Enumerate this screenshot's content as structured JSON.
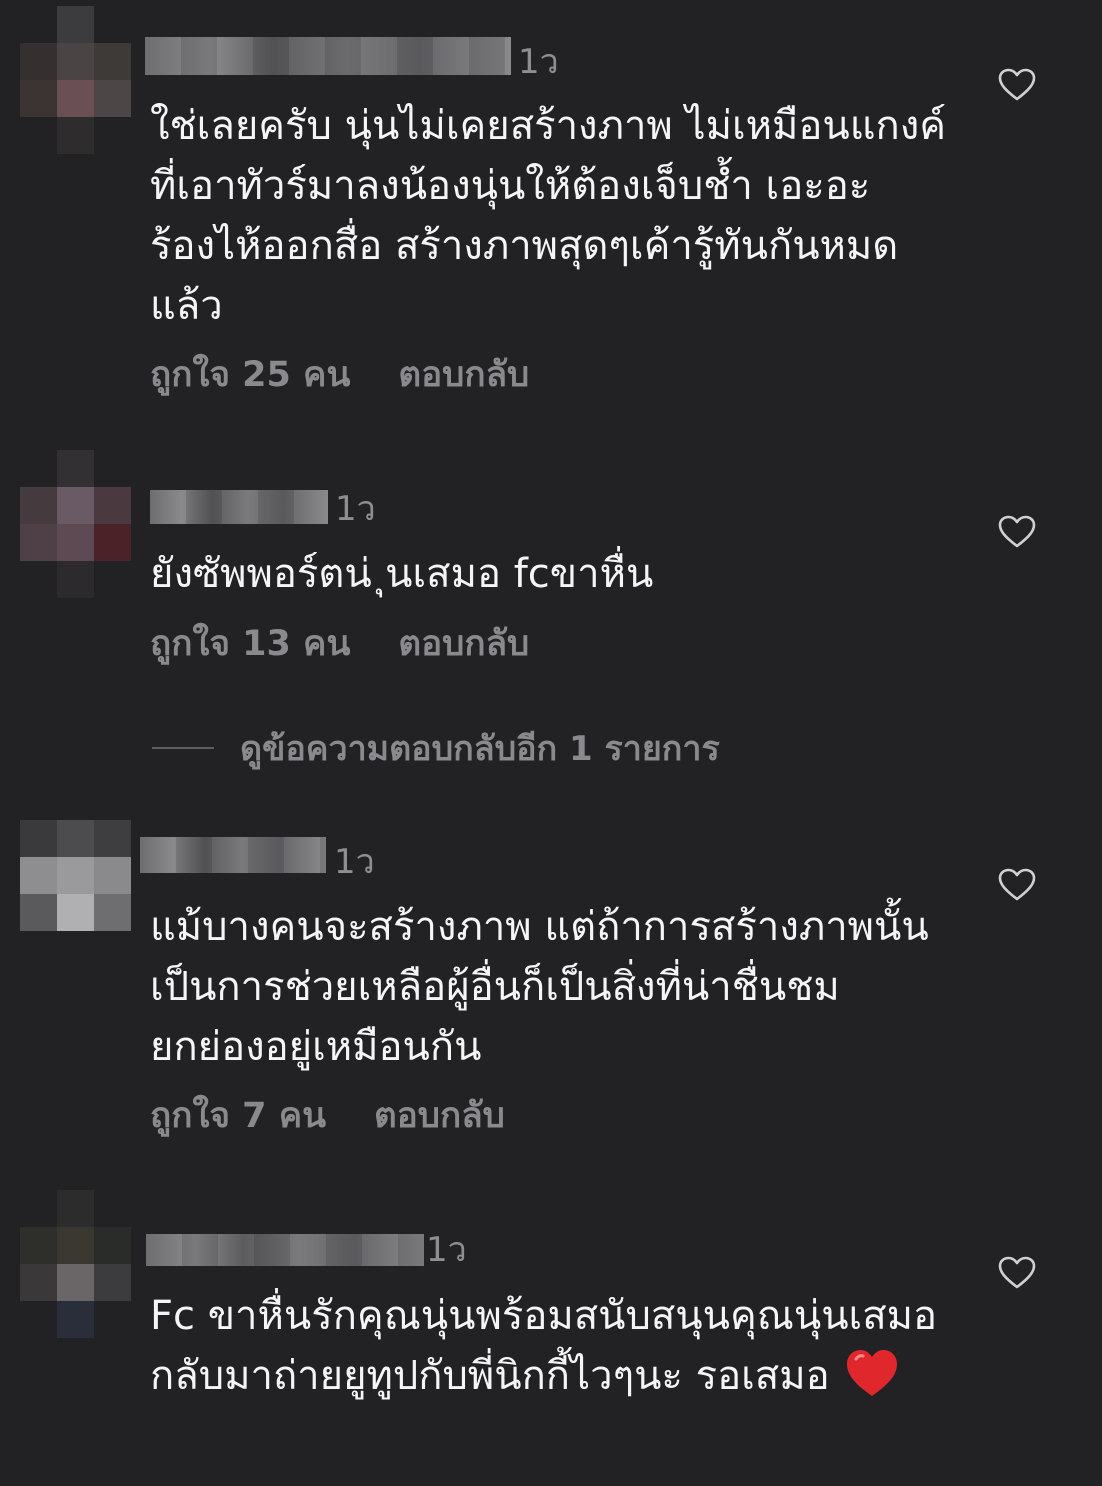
{
  "comments": [
    {
      "time": "1ว",
      "text": "ใช่เลยครับ นุ่นไม่เคยสร้างภาพ ไม่เหมือนแกงค์ที่เอาทัวร์มาลงน้องนุ่นให้ต้องเจ็บช้ำ เอะอะร้องไห้ออกสื่อ สร้างภาพสุดๆเค้ารู้ทันกันหมดแล้ว",
      "likes": "ถูกใจ 25 คน",
      "reply": "ตอบกลับ"
    },
    {
      "time": "1ว",
      "text": "ยังซัพพอร์ตน่ ุนเสมอ fcขาหื่น",
      "likes": "ถูกใจ 13 คน",
      "reply": "ตอบกลับ"
    },
    {
      "time": "1ว",
      "text": "แม้บางคนจะสร้างภาพ แต่ถ้าการสร้างภาพนั้นเป็นการช่วยเหลือผู้อื่นก็เป็นสิ่งที่น่าชื่นชมยกย่องอยู่เหมือนกัน",
      "likes": "ถูกใจ 7 คน",
      "reply": "ตอบกลับ"
    },
    {
      "time": "1ว",
      "text": "Fc ขาหื่นรักคุณนุ่นพร้อมสนับสนุนคุณนุ่นเสมอ กลับมาถ่ายยูทูปกับพี่นิกกี้ไวๆนะ รอเสมอ"
    }
  ],
  "view_more_replies": "ดูข้อความตอบกลับอีก 1 รายการ",
  "colors": {
    "background": "#222224",
    "primary_text": "#f5f5f5",
    "secondary_text": "#8a8a8e",
    "emoji_heart": "#e0282c"
  },
  "icons": [
    "heart-outline-icon",
    "red-heart-emoji"
  ]
}
